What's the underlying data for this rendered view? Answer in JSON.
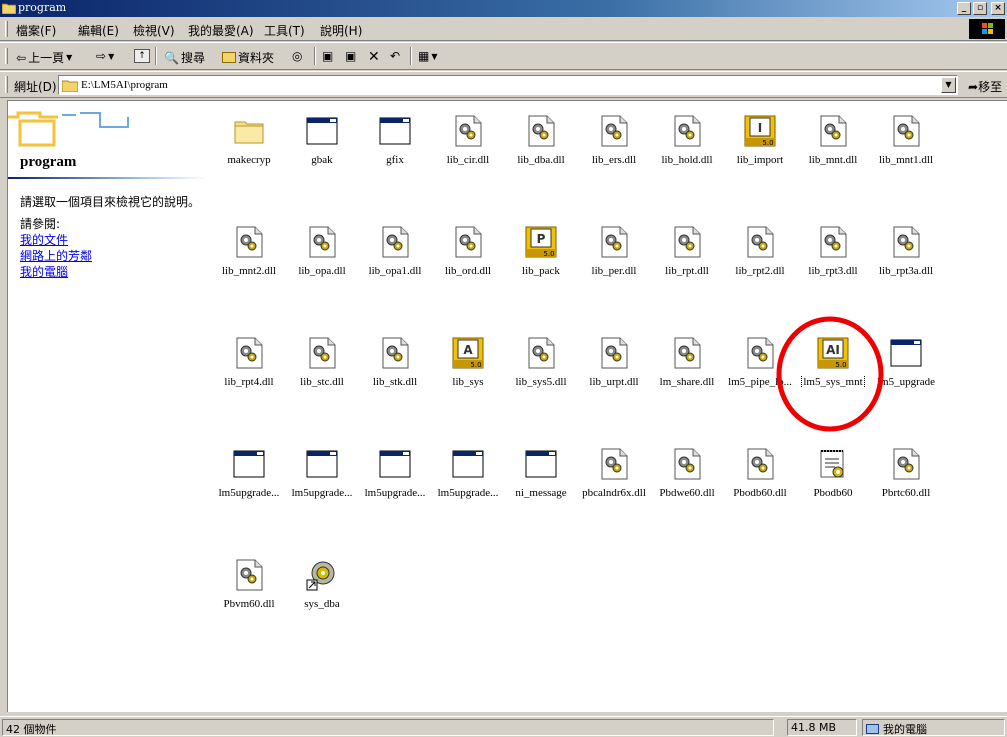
{
  "window": {
    "title": "program"
  },
  "menu": [
    {
      "label": "檔案(F)"
    },
    {
      "label": "編輯(E)"
    },
    {
      "label": "檢視(V)"
    },
    {
      "label": "我的最愛(A)"
    },
    {
      "label": "工具(T)"
    },
    {
      "label": "說明(H)"
    }
  ],
  "toolbar": {
    "back_label": "上一頁",
    "search_label": "搜尋",
    "folders_label": "資料夾"
  },
  "address": {
    "label": "網址(D)",
    "value": "E:\\LM5AI\\program",
    "go_label": "移至"
  },
  "left_pane": {
    "title": "program",
    "hint": "請選取一個項目來檢視它的說明。",
    "see_also": "請參閱:",
    "links": [
      {
        "label": "我的文件"
      },
      {
        "label": "網路上的芳鄰"
      },
      {
        "label": "我的電腦"
      }
    ]
  },
  "files": [
    {
      "name": "makecryp",
      "icon": "folder-icon"
    },
    {
      "name": "gbak",
      "icon": "exe-window-icon"
    },
    {
      "name": "gfix",
      "icon": "exe-window-icon"
    },
    {
      "name": "lib_cir.dll",
      "icon": "dll-gear-icon"
    },
    {
      "name": "lib_dba.dll",
      "icon": "dll-gear-icon"
    },
    {
      "name": "lib_ers.dll",
      "icon": "dll-gear-icon"
    },
    {
      "name": "lib_hold.dll",
      "icon": "dll-gear-icon"
    },
    {
      "name": "lib_import",
      "icon": "app50-icon",
      "letter": "I"
    },
    {
      "name": "lib_mnt.dll",
      "icon": "dll-gear-icon"
    },
    {
      "name": "lib_mnt1.dll",
      "icon": "dll-gear-icon"
    },
    {
      "name": "lib_mnt2.dll",
      "icon": "dll-gear-icon"
    },
    {
      "name": "lib_opa.dll",
      "icon": "dll-gear-icon"
    },
    {
      "name": "lib_opa1.dll",
      "icon": "dll-gear-icon"
    },
    {
      "name": "lib_ord.dll",
      "icon": "dll-gear-icon"
    },
    {
      "name": "lib_pack",
      "icon": "app50-icon",
      "letter": "P"
    },
    {
      "name": "lib_per.dll",
      "icon": "dll-gear-icon"
    },
    {
      "name": "lib_rpt.dll",
      "icon": "dll-gear-icon"
    },
    {
      "name": "lib_rpt2.dll",
      "icon": "dll-gear-icon"
    },
    {
      "name": "lib_rpt3.dll",
      "icon": "dll-gear-icon"
    },
    {
      "name": "lib_rpt3a.dll",
      "icon": "dll-gear-icon"
    },
    {
      "name": "lib_rpt4.dll",
      "icon": "dll-gear-icon"
    },
    {
      "name": "lib_stc.dll",
      "icon": "dll-gear-icon"
    },
    {
      "name": "lib_stk.dll",
      "icon": "dll-gear-icon"
    },
    {
      "name": "lib_sys",
      "icon": "app50-icon",
      "letter": "A"
    },
    {
      "name": "lib_sys5.dll",
      "icon": "dll-gear-icon"
    },
    {
      "name": "lib_urpt.dll",
      "icon": "dll-gear-icon"
    },
    {
      "name": "lm_share.dll",
      "icon": "dll-gear-icon"
    },
    {
      "name": "lm5_pipe_lo...",
      "icon": "dll-gear-icon"
    },
    {
      "name": "lm5_sys_mnt",
      "icon": "app50-icon",
      "letter": "AI",
      "selected": true
    },
    {
      "name": "lm5_upgrade",
      "icon": "exe-window-icon"
    },
    {
      "name": "lm5upgrade...",
      "icon": "exe-window-icon"
    },
    {
      "name": "lm5upgrade...",
      "icon": "exe-window-icon"
    },
    {
      "name": "lm5upgrade...",
      "icon": "exe-window-icon"
    },
    {
      "name": "lm5upgrade...",
      "icon": "exe-window-icon"
    },
    {
      "name": "ni_message",
      "icon": "exe-window-icon"
    },
    {
      "name": "pbcalndr6x.dll",
      "icon": "dll-gear-icon"
    },
    {
      "name": "Pbdwe60.dll",
      "icon": "dll-gear-icon"
    },
    {
      "name": "Pbodb60.dll",
      "icon": "dll-gear-icon"
    },
    {
      "name": "Pbodb60",
      "icon": "config-settings-icon"
    },
    {
      "name": "Pbrtc60.dll",
      "icon": "dll-gear-icon"
    },
    {
      "name": "Pbvm60.dll",
      "icon": "dll-gear-icon"
    },
    {
      "name": "sys_dba",
      "icon": "shortcut-gear-icon"
    }
  ],
  "status": {
    "count": "42 個物件",
    "size": "41.8 MB",
    "location": "我的電腦"
  },
  "colors": {
    "title_active": "#0a246a",
    "annotation_red": "#ee0000",
    "link": "#0000ff"
  }
}
